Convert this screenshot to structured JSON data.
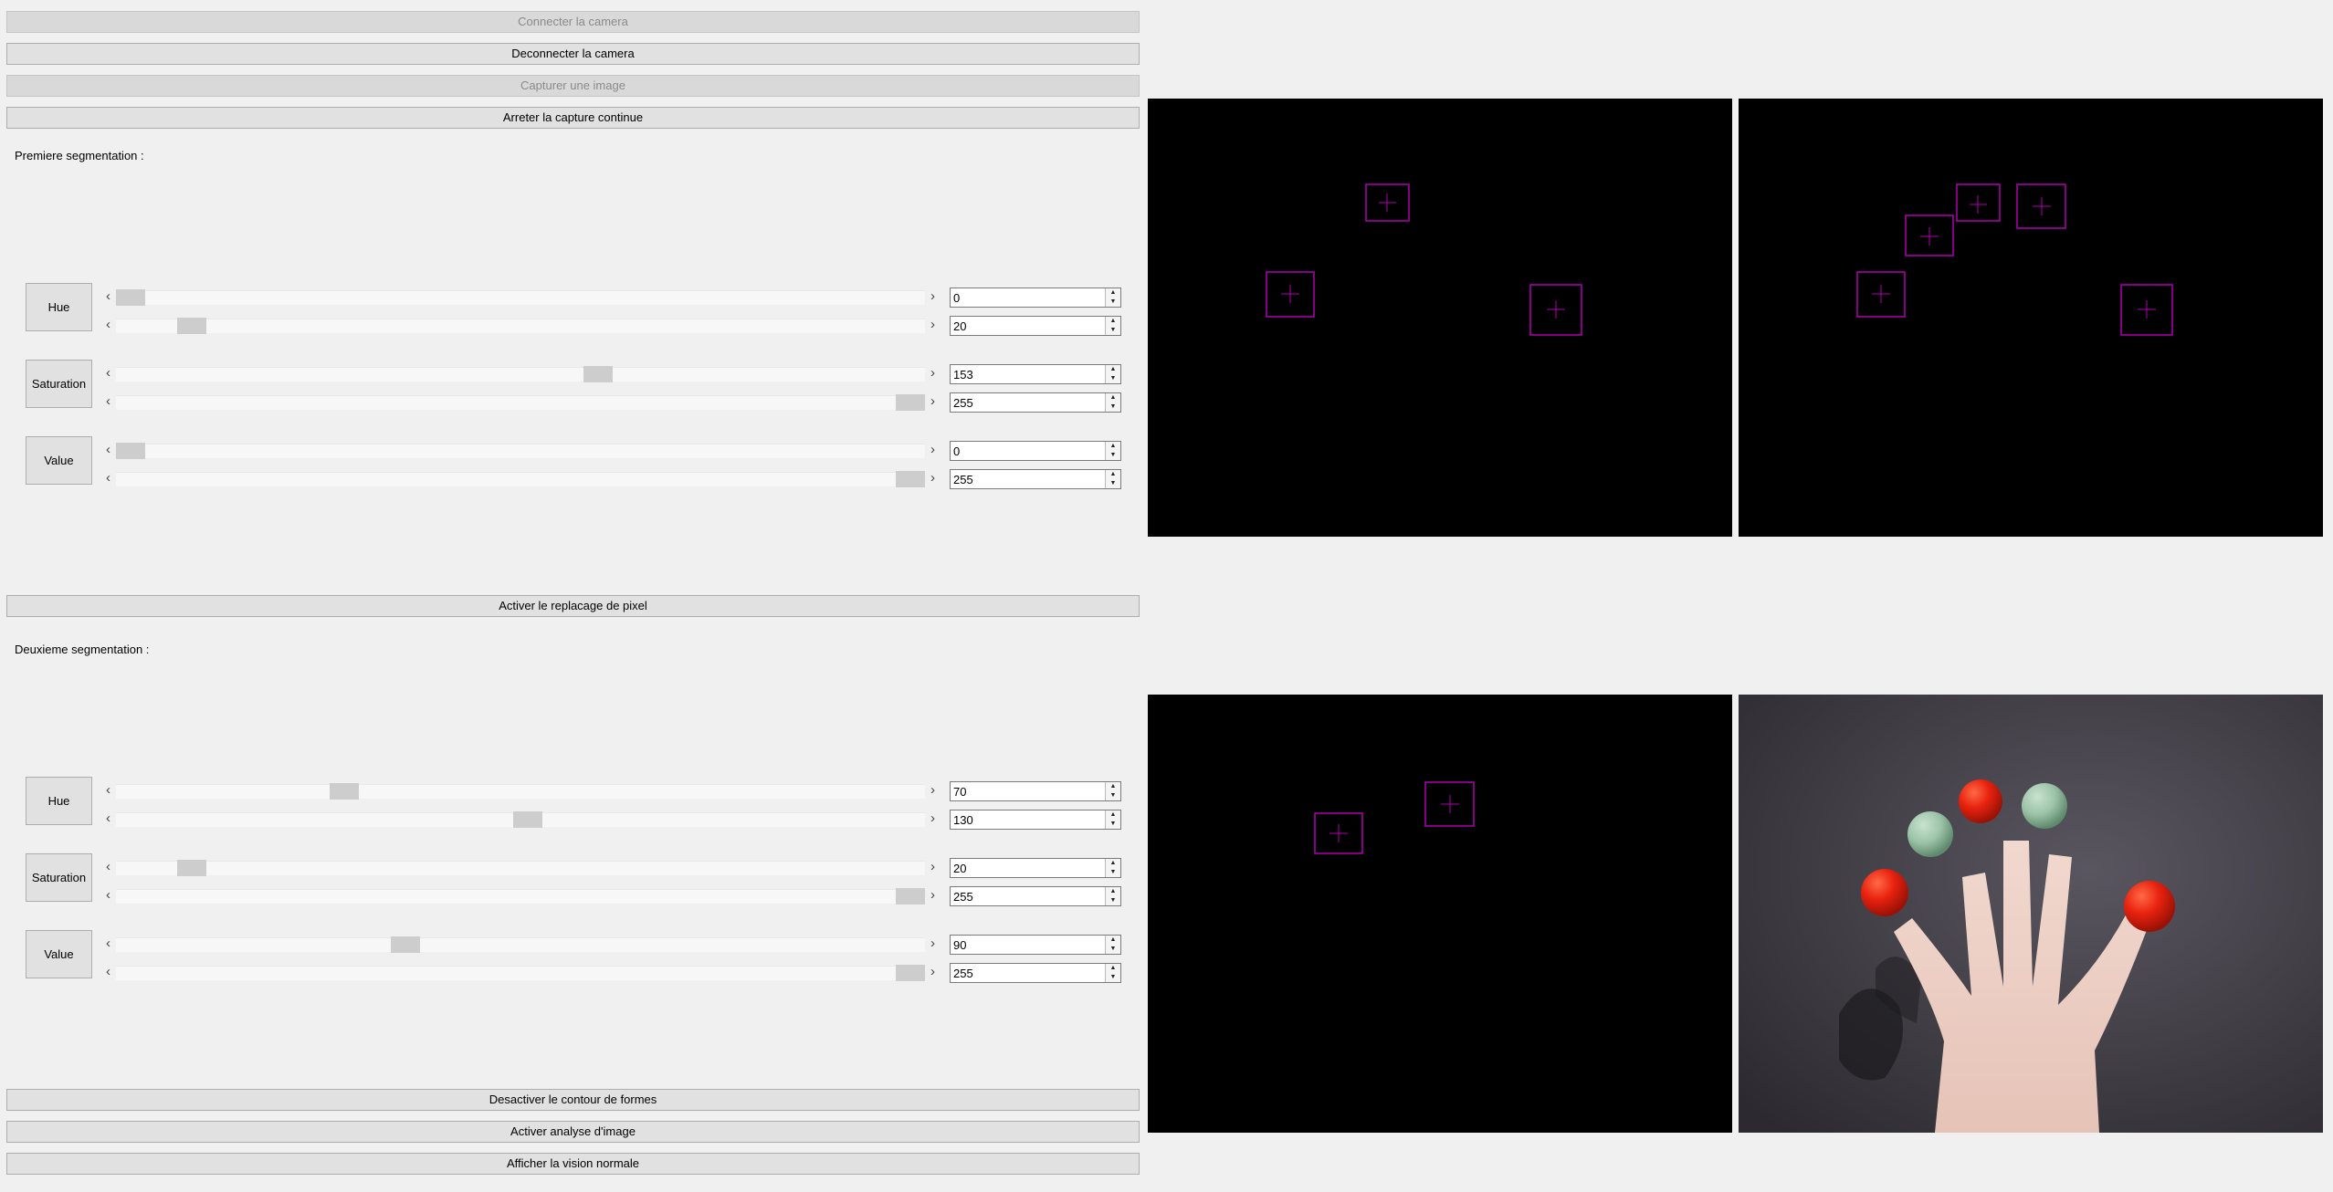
{
  "buttons": {
    "connect_camera": "Connecter la camera",
    "disconnect_camera": "Deconnecter la camera",
    "capture_image": "Capturer une image",
    "stop_continuous_capture": "Arreter la capture continue",
    "enable_pixel_replacement": "Activer le replacage de pixel",
    "disable_shape_contour": "Desactiver le contour de formes",
    "enable_image_analysis": "Activer analyse d'image",
    "show_normal_vision": "Afficher la vision normale"
  },
  "first_segmentation": {
    "title": "Premiere segmentation :",
    "channels": [
      {
        "label": "Hue",
        "min": 0,
        "max": 20,
        "min_text": "0",
        "max_text": "20"
      },
      {
        "label": "Saturation",
        "min": 153,
        "max": 255,
        "min_text": "153",
        "max_text": "255"
      },
      {
        "label": "Value",
        "min": 0,
        "max": 255,
        "min_text": "0",
        "max_text": "255"
      }
    ]
  },
  "second_segmentation": {
    "title": "Deuxieme segmentation :",
    "channels": [
      {
        "label": "Hue",
        "min": 70,
        "max": 130,
        "min_text": "70",
        "max_text": "130"
      },
      {
        "label": "Saturation",
        "min": 20,
        "max": 255,
        "min_text": "20",
        "max_text": "255"
      },
      {
        "label": "Value",
        "min": 90,
        "max": 255,
        "min_text": "90",
        "max_text": "255"
      }
    ]
  },
  "colors": {
    "marker": "#b000b0",
    "button_bg": "#e1e1e1",
    "disabled_text": "#8a8a8a",
    "red_ball": "#e8220f",
    "green_ball": "#9cc3a8"
  },
  "icons": {
    "slider_left": "chevron-left-icon",
    "slider_right": "chevron-right-icon",
    "spin_up": "caret-up-icon",
    "spin_down": "caret-down-icon",
    "marker": "crosshair-box-icon"
  }
}
